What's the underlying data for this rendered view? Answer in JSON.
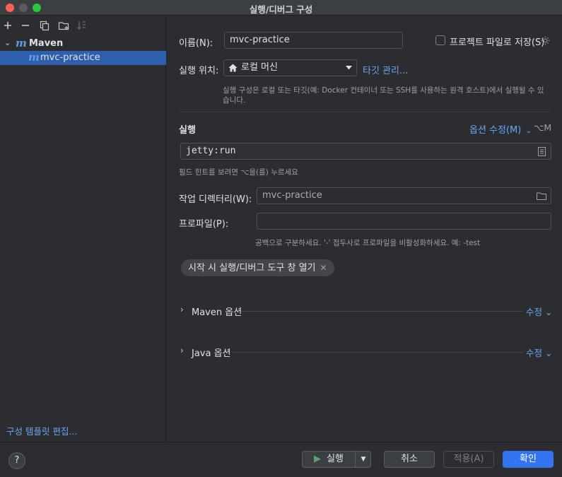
{
  "window": {
    "title": "실행/디버그 구성"
  },
  "sidebar": {
    "toolbar": {
      "add": "+",
      "remove": "−"
    },
    "tree": {
      "group_label": "Maven",
      "item_label": "mvc-practice"
    },
    "template_link": "구성 템플릿 편집..."
  },
  "form": {
    "name_label": "이름(N):",
    "name_value": "mvc-practice",
    "store_as_project_file_label": "프로젝트 파일로 저장(S)",
    "run_on_label": "실행 위치:",
    "run_on_value": "로컬 머신",
    "manage_targets_link": "타깃 관리...",
    "run_on_hint_line1": "실행 구성은 로컬 또는 타깃(예: Docker 컨테이너 또는 SSH를 사용하는 원격 호스트)에서 실행될 수 있",
    "run_on_hint_line2": "습니다.",
    "run_section_title": "실행",
    "modify_options_link": "옵션 수정(M)",
    "modify_options_shortcut": "⌥M",
    "command_value": "jetty:run",
    "command_hint": "필드 힌트를 보려면 ⌥을(를) 누르세요",
    "workdir_label": "작업 디렉터리(W):",
    "workdir_value": "mvc-practice",
    "profiles_label": "프로파일(P):",
    "profiles_value": "",
    "profiles_hint": "공백으로 구분하세요. '-' 접두사로 프로파일을 비활성화하세요. 예: -test",
    "chip_label": "시작 시 실행/디버그 도구 창 열기",
    "maven_options_label": "Maven 옵션",
    "java_options_label": "Java 옵션",
    "edit_link": "수정"
  },
  "buttons": {
    "help": "?",
    "run": "실행",
    "cancel": "취소",
    "apply": "적용(A)",
    "ok": "확인"
  },
  "colors": {
    "accent": "#3574f0",
    "link": "#6aa6f8",
    "selection": "#2e5fad",
    "background": "#2b2d30"
  }
}
